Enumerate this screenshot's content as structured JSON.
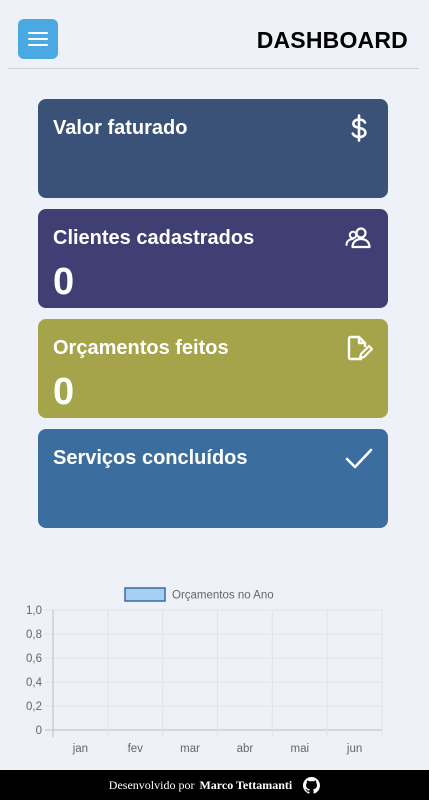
{
  "header": {
    "title": "DASHBOARD",
    "menu_icon": "hamburger-menu-icon",
    "menu_color": "#4aa8e3"
  },
  "cards": [
    {
      "label": "Valor faturado",
      "value": "",
      "icon": "dollar-icon",
      "color": "#3b5278"
    },
    {
      "label": "Clientes cadastrados",
      "value": "0",
      "icon": "users-icon",
      "color": "#3f3f73"
    },
    {
      "label": "Orçamentos feitos",
      "value": "0",
      "icon": "edit-document-icon",
      "color": "#a6a44a"
    },
    {
      "label": "Serviços concluídos",
      "value": "",
      "icon": "check-icon",
      "color": "#3b6e9f"
    }
  ],
  "chart_data": {
    "type": "bar",
    "categories": [
      "jan",
      "fev",
      "mar",
      "abr",
      "mai",
      "jun"
    ],
    "series": [
      {
        "name": "Orçamentos no Ano",
        "values": [
          0,
          0,
          0,
          0,
          0,
          0
        ],
        "fill": "#a3d0f3",
        "stroke": "#3d6a9e"
      }
    ],
    "yticks": [
      "1,0",
      "0,8",
      "0,6",
      "0,4",
      "0,2",
      "0"
    ],
    "ylim": [
      0,
      1
    ],
    "grid": true,
    "legend": "top"
  },
  "footer": {
    "prefix": "Desenvolvido por",
    "author": "Marco Tettamanti",
    "icon": "github-icon"
  }
}
